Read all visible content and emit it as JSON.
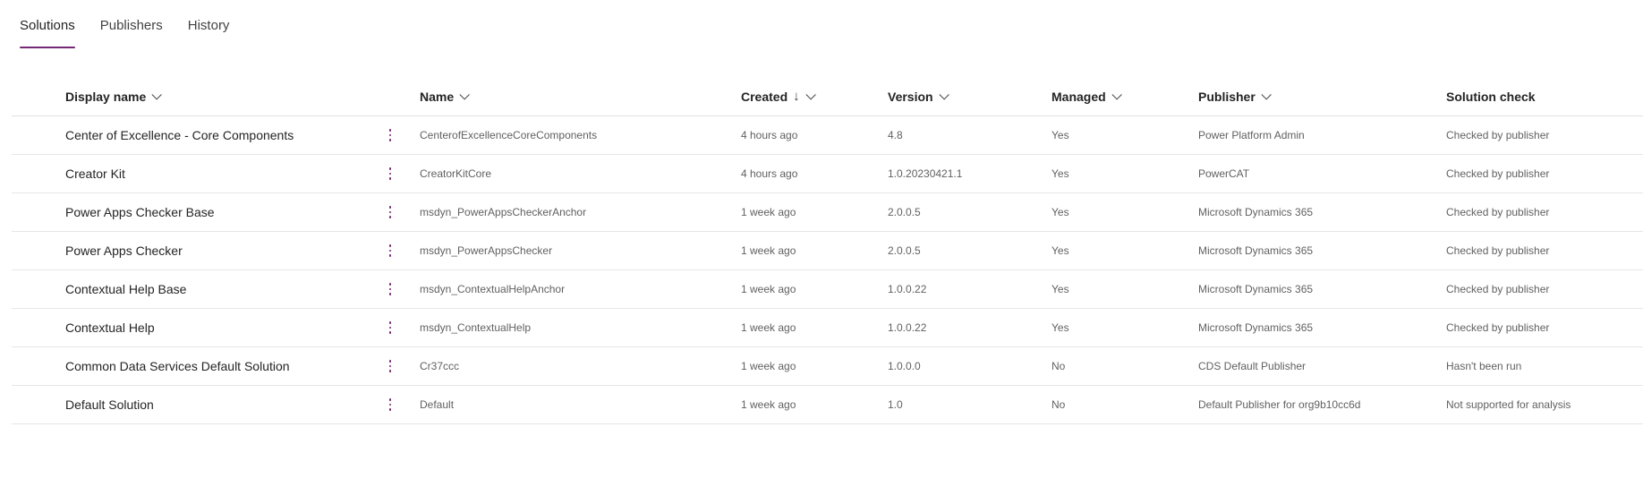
{
  "tabs": [
    {
      "label": "Solutions",
      "active": true
    },
    {
      "label": "Publishers",
      "active": false
    },
    {
      "label": "History",
      "active": false
    }
  ],
  "columns": {
    "display_name": "Display name",
    "name": "Name",
    "created": "Created",
    "created_sort": "↓",
    "version": "Version",
    "managed": "Managed",
    "publisher": "Publisher",
    "solution_check": "Solution check"
  },
  "rows": [
    {
      "display_name": "Center of Excellence - Core Components",
      "name": "CenterofExcellenceCoreComponents",
      "created": "4 hours ago",
      "version": "4.8",
      "managed": "Yes",
      "publisher": "Power Platform Admin",
      "solution_check": "Checked by publisher"
    },
    {
      "display_name": "Creator Kit",
      "name": "CreatorKitCore",
      "created": "4 hours ago",
      "version": "1.0.20230421.1",
      "managed": "Yes",
      "publisher": "PowerCAT",
      "solution_check": "Checked by publisher"
    },
    {
      "display_name": "Power Apps Checker Base",
      "name": "msdyn_PowerAppsCheckerAnchor",
      "created": "1 week ago",
      "version": "2.0.0.5",
      "managed": "Yes",
      "publisher": "Microsoft Dynamics 365",
      "solution_check": "Checked by publisher"
    },
    {
      "display_name": "Power Apps Checker",
      "name": "msdyn_PowerAppsChecker",
      "created": "1 week ago",
      "version": "2.0.0.5",
      "managed": "Yes",
      "publisher": "Microsoft Dynamics 365",
      "solution_check": "Checked by publisher"
    },
    {
      "display_name": "Contextual Help Base",
      "name": "msdyn_ContextualHelpAnchor",
      "created": "1 week ago",
      "version": "1.0.0.22",
      "managed": "Yes",
      "publisher": "Microsoft Dynamics 365",
      "solution_check": "Checked by publisher"
    },
    {
      "display_name": "Contextual Help",
      "name": "msdyn_ContextualHelp",
      "created": "1 week ago",
      "version": "1.0.0.22",
      "managed": "Yes",
      "publisher": "Microsoft Dynamics 365",
      "solution_check": "Checked by publisher"
    },
    {
      "display_name": "Common Data Services Default Solution",
      "name": "Cr37ccc",
      "created": "1 week ago",
      "version": "1.0.0.0",
      "managed": "No",
      "publisher": "CDS Default Publisher",
      "solution_check": "Hasn't been run"
    },
    {
      "display_name": "Default Solution",
      "name": "Default",
      "created": "1 week ago",
      "version": "1.0",
      "managed": "No",
      "publisher": "Default Publisher for org9b10cc6d",
      "solution_check": "Not supported for analysis"
    }
  ],
  "icons": {
    "row_more": "more-vertical-icon",
    "sort_chevron": "chevron-down-icon",
    "sort_desc": "arrow-down-icon"
  },
  "colors": {
    "accent": "#742774",
    "divider": "#e6e6e6"
  }
}
